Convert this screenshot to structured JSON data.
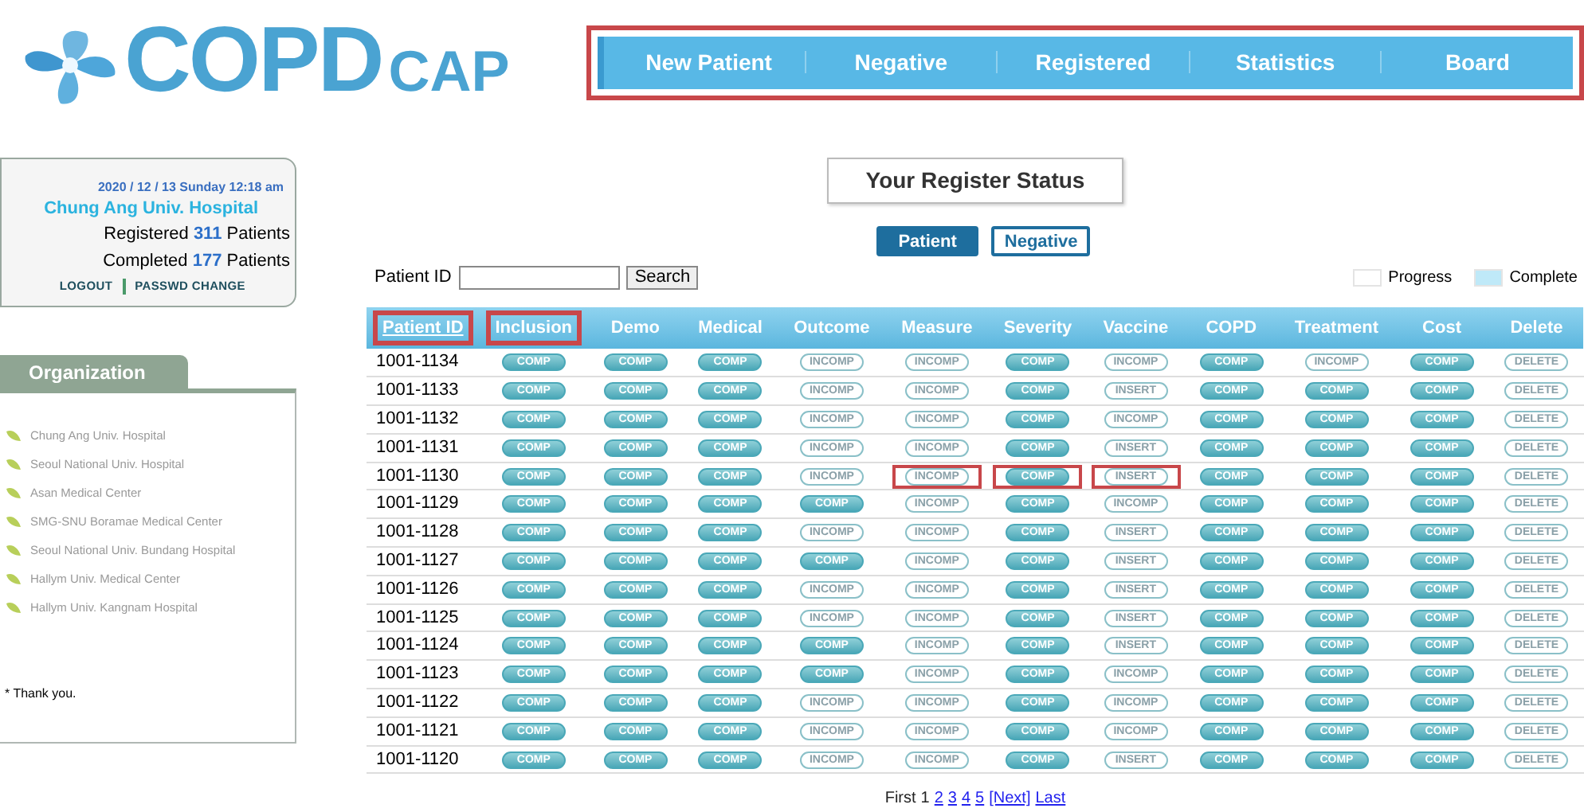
{
  "logo": {
    "main": "COPD",
    "sub": "CAP"
  },
  "nav": {
    "highlighted": true,
    "items": [
      {
        "label": "New Patient"
      },
      {
        "label": "Negative"
      },
      {
        "label": "Registered"
      },
      {
        "label": "Statistics"
      },
      {
        "label": "Board"
      }
    ]
  },
  "user_panel": {
    "datetime": "2020 / 12 / 13 Sunday 12:18 am",
    "hospital": "Chung Ang Univ. Hospital",
    "registered": {
      "before": "Registered",
      "count": "311",
      "after": "Patients"
    },
    "completed": {
      "before": "Completed",
      "count": "177",
      "after": "Patients"
    },
    "links": [
      {
        "label": "LOGOUT"
      },
      {
        "label": "PASSWD CHANGE"
      }
    ]
  },
  "organization": {
    "title": "Organization",
    "items": [
      "Chung Ang Univ. Hospital",
      "Seoul National Univ. Hospital",
      "Asan Medical Center",
      "SMG-SNU Boramae Medical Center",
      "Seoul National Univ. Bundang Hospital",
      "Hallym Univ. Medical Center",
      "Hallym Univ. Kangnam Hospital"
    ],
    "note": "* Thank you."
  },
  "title": "Your Register Status",
  "toggles": [
    {
      "label": "Patient",
      "selected": true
    },
    {
      "label": "Negative",
      "selected": false
    }
  ],
  "search": {
    "label": "Patient ID",
    "button": "Search"
  },
  "legend": [
    {
      "label": "Progress",
      "color": "#ffffff"
    },
    {
      "label": "Complete",
      "color": "#bfe9f8"
    }
  ],
  "table": {
    "columns": [
      {
        "label": "Patient ID",
        "highlighted": true
      },
      {
        "label": "Inclusion",
        "highlighted": true
      },
      {
        "label": "Demo",
        "highlighted": false
      },
      {
        "label": "Medical",
        "highlighted": false
      },
      {
        "label": "Outcome",
        "highlighted": false
      },
      {
        "label": "Measure",
        "highlighted": false
      },
      {
        "label": "Severity",
        "highlighted": false
      },
      {
        "label": "Vaccine",
        "highlighted": false
      },
      {
        "label": "COPD",
        "highlighted": false
      },
      {
        "label": "Treatment",
        "highlighted": false
      },
      {
        "label": "Cost",
        "highlighted": false
      },
      {
        "label": "Delete",
        "highlighted": false
      }
    ],
    "rows": [
      {
        "cells": [
          {
            "label": "1001-1134",
            "kind": "id"
          },
          {
            "label": "COMP",
            "kind": "filled"
          },
          {
            "label": "COMP",
            "kind": "filled"
          },
          {
            "label": "COMP",
            "kind": "filled"
          },
          {
            "label": "INCOMP",
            "kind": "outline"
          },
          {
            "label": "INCOMP",
            "kind": "outline"
          },
          {
            "label": "COMP",
            "kind": "filled"
          },
          {
            "label": "INCOMP",
            "kind": "outline"
          },
          {
            "label": "COMP",
            "kind": "filled"
          },
          {
            "label": "INCOMP",
            "kind": "outline"
          },
          {
            "label": "COMP",
            "kind": "filled"
          },
          {
            "label": "DELETE",
            "kind": "outline"
          }
        ]
      },
      {
        "cells": [
          {
            "label": "1001-1133",
            "kind": "id"
          },
          {
            "label": "COMP",
            "kind": "filled"
          },
          {
            "label": "COMP",
            "kind": "filled"
          },
          {
            "label": "COMP",
            "kind": "filled"
          },
          {
            "label": "INCOMP",
            "kind": "outline"
          },
          {
            "label": "INCOMP",
            "kind": "outline"
          },
          {
            "label": "COMP",
            "kind": "filled"
          },
          {
            "label": "INSERT",
            "kind": "outline"
          },
          {
            "label": "COMP",
            "kind": "filled"
          },
          {
            "label": "COMP",
            "kind": "filled"
          },
          {
            "label": "COMP",
            "kind": "filled"
          },
          {
            "label": "DELETE",
            "kind": "outline"
          }
        ]
      },
      {
        "cells": [
          {
            "label": "1001-1132",
            "kind": "id"
          },
          {
            "label": "COMP",
            "kind": "filled"
          },
          {
            "label": "COMP",
            "kind": "filled"
          },
          {
            "label": "COMP",
            "kind": "filled"
          },
          {
            "label": "INCOMP",
            "kind": "outline"
          },
          {
            "label": "INCOMP",
            "kind": "outline"
          },
          {
            "label": "COMP",
            "kind": "filled"
          },
          {
            "label": "INCOMP",
            "kind": "outline"
          },
          {
            "label": "COMP",
            "kind": "filled"
          },
          {
            "label": "COMP",
            "kind": "filled"
          },
          {
            "label": "COMP",
            "kind": "filled"
          },
          {
            "label": "DELETE",
            "kind": "outline"
          }
        ]
      },
      {
        "cells": [
          {
            "label": "1001-1131",
            "kind": "id"
          },
          {
            "label": "COMP",
            "kind": "filled"
          },
          {
            "label": "COMP",
            "kind": "filled"
          },
          {
            "label": "COMP",
            "kind": "filled"
          },
          {
            "label": "INCOMP",
            "kind": "outline"
          },
          {
            "label": "INCOMP",
            "kind": "outline"
          },
          {
            "label": "COMP",
            "kind": "filled"
          },
          {
            "label": "INSERT",
            "kind": "outline"
          },
          {
            "label": "COMP",
            "kind": "filled"
          },
          {
            "label": "COMP",
            "kind": "filled"
          },
          {
            "label": "COMP",
            "kind": "filled"
          },
          {
            "label": "DELETE",
            "kind": "outline"
          }
        ]
      },
      {
        "cells": [
          {
            "label": "1001-1130",
            "kind": "id"
          },
          {
            "label": "COMP",
            "kind": "filled"
          },
          {
            "label": "COMP",
            "kind": "filled"
          },
          {
            "label": "COMP",
            "kind": "filled"
          },
          {
            "label": "INCOMP",
            "kind": "outline"
          },
          {
            "label": "INCOMP",
            "kind": "outline",
            "highlighted": true
          },
          {
            "label": "COMP",
            "kind": "filled",
            "highlighted": true
          },
          {
            "label": "INSERT",
            "kind": "outline",
            "highlighted": true
          },
          {
            "label": "COMP",
            "kind": "filled"
          },
          {
            "label": "COMP",
            "kind": "filled"
          },
          {
            "label": "COMP",
            "kind": "filled"
          },
          {
            "label": "DELETE",
            "kind": "outline"
          }
        ]
      },
      {
        "cells": [
          {
            "label": "1001-1129",
            "kind": "id"
          },
          {
            "label": "COMP",
            "kind": "filled"
          },
          {
            "label": "COMP",
            "kind": "filled"
          },
          {
            "label": "COMP",
            "kind": "filled"
          },
          {
            "label": "COMP",
            "kind": "filled"
          },
          {
            "label": "INCOMP",
            "kind": "outline"
          },
          {
            "label": "COMP",
            "kind": "filled"
          },
          {
            "label": "INCOMP",
            "kind": "outline"
          },
          {
            "label": "COMP",
            "kind": "filled"
          },
          {
            "label": "COMP",
            "kind": "filled"
          },
          {
            "label": "COMP",
            "kind": "filled"
          },
          {
            "label": "DELETE",
            "kind": "outline"
          }
        ]
      },
      {
        "cells": [
          {
            "label": "1001-1128",
            "kind": "id"
          },
          {
            "label": "COMP",
            "kind": "filled"
          },
          {
            "label": "COMP",
            "kind": "filled"
          },
          {
            "label": "COMP",
            "kind": "filled"
          },
          {
            "label": "INCOMP",
            "kind": "outline"
          },
          {
            "label": "INCOMP",
            "kind": "outline"
          },
          {
            "label": "COMP",
            "kind": "filled"
          },
          {
            "label": "INSERT",
            "kind": "outline"
          },
          {
            "label": "COMP",
            "kind": "filled"
          },
          {
            "label": "COMP",
            "kind": "filled"
          },
          {
            "label": "COMP",
            "kind": "filled"
          },
          {
            "label": "DELETE",
            "kind": "outline"
          }
        ]
      },
      {
        "cells": [
          {
            "label": "1001-1127",
            "kind": "id"
          },
          {
            "label": "COMP",
            "kind": "filled"
          },
          {
            "label": "COMP",
            "kind": "filled"
          },
          {
            "label": "COMP",
            "kind": "filled"
          },
          {
            "label": "COMP",
            "kind": "filled"
          },
          {
            "label": "INCOMP",
            "kind": "outline"
          },
          {
            "label": "COMP",
            "kind": "filled"
          },
          {
            "label": "INSERT",
            "kind": "outline"
          },
          {
            "label": "COMP",
            "kind": "filled"
          },
          {
            "label": "COMP",
            "kind": "filled"
          },
          {
            "label": "COMP",
            "kind": "filled"
          },
          {
            "label": "DELETE",
            "kind": "outline"
          }
        ]
      },
      {
        "cells": [
          {
            "label": "1001-1126",
            "kind": "id"
          },
          {
            "label": "COMP",
            "kind": "filled"
          },
          {
            "label": "COMP",
            "kind": "filled"
          },
          {
            "label": "COMP",
            "kind": "filled"
          },
          {
            "label": "INCOMP",
            "kind": "outline"
          },
          {
            "label": "INCOMP",
            "kind": "outline"
          },
          {
            "label": "COMP",
            "kind": "filled"
          },
          {
            "label": "INSERT",
            "kind": "outline"
          },
          {
            "label": "COMP",
            "kind": "filled"
          },
          {
            "label": "COMP",
            "kind": "filled"
          },
          {
            "label": "COMP",
            "kind": "filled"
          },
          {
            "label": "DELETE",
            "kind": "outline"
          }
        ]
      },
      {
        "cells": [
          {
            "label": "1001-1125",
            "kind": "id"
          },
          {
            "label": "COMP",
            "kind": "filled"
          },
          {
            "label": "COMP",
            "kind": "filled"
          },
          {
            "label": "COMP",
            "kind": "filled"
          },
          {
            "label": "INCOMP",
            "kind": "outline"
          },
          {
            "label": "INCOMP",
            "kind": "outline"
          },
          {
            "label": "COMP",
            "kind": "filled"
          },
          {
            "label": "INSERT",
            "kind": "outline"
          },
          {
            "label": "COMP",
            "kind": "filled"
          },
          {
            "label": "COMP",
            "kind": "filled"
          },
          {
            "label": "COMP",
            "kind": "filled"
          },
          {
            "label": "DELETE",
            "kind": "outline"
          }
        ]
      },
      {
        "cells": [
          {
            "label": "1001-1124",
            "kind": "id"
          },
          {
            "label": "COMP",
            "kind": "filled"
          },
          {
            "label": "COMP",
            "kind": "filled"
          },
          {
            "label": "COMP",
            "kind": "filled"
          },
          {
            "label": "COMP",
            "kind": "filled"
          },
          {
            "label": "INCOMP",
            "kind": "outline"
          },
          {
            "label": "COMP",
            "kind": "filled"
          },
          {
            "label": "INSERT",
            "kind": "outline"
          },
          {
            "label": "COMP",
            "kind": "filled"
          },
          {
            "label": "COMP",
            "kind": "filled"
          },
          {
            "label": "COMP",
            "kind": "filled"
          },
          {
            "label": "DELETE",
            "kind": "outline"
          }
        ]
      },
      {
        "cells": [
          {
            "label": "1001-1123",
            "kind": "id"
          },
          {
            "label": "COMP",
            "kind": "filled"
          },
          {
            "label": "COMP",
            "kind": "filled"
          },
          {
            "label": "COMP",
            "kind": "filled"
          },
          {
            "label": "COMP",
            "kind": "filled"
          },
          {
            "label": "INCOMP",
            "kind": "outline"
          },
          {
            "label": "COMP",
            "kind": "filled"
          },
          {
            "label": "INCOMP",
            "kind": "outline"
          },
          {
            "label": "COMP",
            "kind": "filled"
          },
          {
            "label": "COMP",
            "kind": "filled"
          },
          {
            "label": "COMP",
            "kind": "filled"
          },
          {
            "label": "DELETE",
            "kind": "outline"
          }
        ]
      },
      {
        "cells": [
          {
            "label": "1001-1122",
            "kind": "id"
          },
          {
            "label": "COMP",
            "kind": "filled"
          },
          {
            "label": "COMP",
            "kind": "filled"
          },
          {
            "label": "COMP",
            "kind": "filled"
          },
          {
            "label": "INCOMP",
            "kind": "outline"
          },
          {
            "label": "INCOMP",
            "kind": "outline"
          },
          {
            "label": "COMP",
            "kind": "filled"
          },
          {
            "label": "INCOMP",
            "kind": "outline"
          },
          {
            "label": "COMP",
            "kind": "filled"
          },
          {
            "label": "COMP",
            "kind": "filled"
          },
          {
            "label": "COMP",
            "kind": "filled"
          },
          {
            "label": "DELETE",
            "kind": "outline"
          }
        ]
      },
      {
        "cells": [
          {
            "label": "1001-1121",
            "kind": "id"
          },
          {
            "label": "COMP",
            "kind": "filled"
          },
          {
            "label": "COMP",
            "kind": "filled"
          },
          {
            "label": "COMP",
            "kind": "filled"
          },
          {
            "label": "INCOMP",
            "kind": "outline"
          },
          {
            "label": "INCOMP",
            "kind": "outline"
          },
          {
            "label": "COMP",
            "kind": "filled"
          },
          {
            "label": "INCOMP",
            "kind": "outline"
          },
          {
            "label": "COMP",
            "kind": "filled"
          },
          {
            "label": "COMP",
            "kind": "filled"
          },
          {
            "label": "COMP",
            "kind": "filled"
          },
          {
            "label": "DELETE",
            "kind": "outline"
          }
        ]
      },
      {
        "cells": [
          {
            "label": "1001-1120",
            "kind": "id"
          },
          {
            "label": "COMP",
            "kind": "filled"
          },
          {
            "label": "COMP",
            "kind": "filled"
          },
          {
            "label": "COMP",
            "kind": "filled"
          },
          {
            "label": "INCOMP",
            "kind": "outline"
          },
          {
            "label": "INCOMP",
            "kind": "outline"
          },
          {
            "label": "COMP",
            "kind": "filled"
          },
          {
            "label": "INSERT",
            "kind": "outline"
          },
          {
            "label": "COMP",
            "kind": "filled"
          },
          {
            "label": "COMP",
            "kind": "filled"
          },
          {
            "label": "COMP",
            "kind": "filled"
          },
          {
            "label": "DELETE",
            "kind": "outline"
          }
        ]
      }
    ]
  },
  "pagination": {
    "items": [
      {
        "label": "First",
        "kind": "text"
      },
      {
        "label": "1",
        "kind": "text"
      },
      {
        "label": "2",
        "kind": "link"
      },
      {
        "label": "3",
        "kind": "link"
      },
      {
        "label": "4",
        "kind": "link"
      },
      {
        "label": "5",
        "kind": "link"
      },
      {
        "label": "[Next]",
        "kind": "link"
      },
      {
        "label": "Last",
        "kind": "link"
      }
    ]
  }
}
